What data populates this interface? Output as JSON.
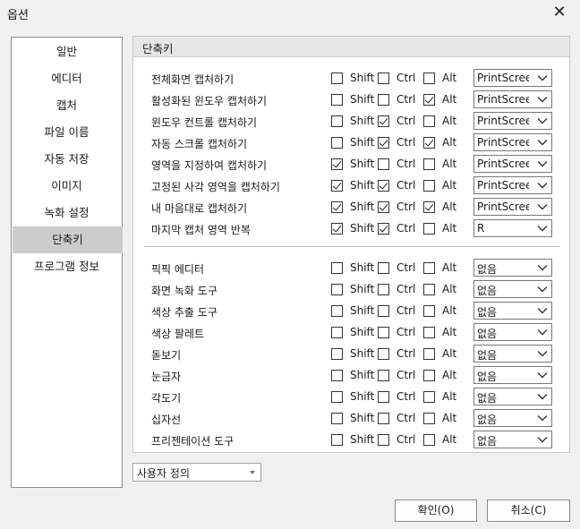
{
  "window": {
    "title": "옵션",
    "close_glyph": "✕"
  },
  "sidebar": {
    "items": [
      {
        "label": "일반"
      },
      {
        "label": "에디터"
      },
      {
        "label": "캡처"
      },
      {
        "label": "파일 이름"
      },
      {
        "label": "자동 저장"
      },
      {
        "label": "이미지"
      },
      {
        "label": "녹화 설정"
      },
      {
        "label": "단축키",
        "active": true
      },
      {
        "label": "프로그램 정보"
      }
    ]
  },
  "panel": {
    "title": "단축키",
    "modifier_labels": {
      "shift": "Shift",
      "ctrl": "Ctrl",
      "alt": "Alt"
    },
    "capture_shortcuts": [
      {
        "label": "전체화면 캡처하기",
        "shift": false,
        "ctrl": false,
        "alt": false,
        "key": "PrintScreen"
      },
      {
        "label": "활성화된 윈도우 캡처하기",
        "shift": false,
        "ctrl": false,
        "alt": true,
        "key": "PrintScreen"
      },
      {
        "label": "윈도우 컨트롤 캡처하기",
        "shift": false,
        "ctrl": true,
        "alt": false,
        "key": "PrintScreen"
      },
      {
        "label": "자동 스크롤 캡처하기",
        "shift": false,
        "ctrl": true,
        "alt": true,
        "key": "PrintScreen"
      },
      {
        "label": "영역을 지정하여 캡처하기",
        "shift": true,
        "ctrl": false,
        "alt": false,
        "key": "PrintScreen"
      },
      {
        "label": "고정된 사각 영역을 캡처하기",
        "shift": true,
        "ctrl": true,
        "alt": false,
        "key": "PrintScreen"
      },
      {
        "label": "내 마음대로 캡처하기",
        "shift": true,
        "ctrl": true,
        "alt": true,
        "key": "PrintScreen"
      },
      {
        "label": "마지막 캡처 영역 반복",
        "shift": true,
        "ctrl": true,
        "alt": false,
        "key": "R"
      }
    ],
    "tool_shortcuts": [
      {
        "label": "픽픽 에디터",
        "shift": false,
        "ctrl": false,
        "alt": false,
        "key": "없음"
      },
      {
        "label": "화면 녹화 도구",
        "shift": false,
        "ctrl": false,
        "alt": false,
        "key": "없음"
      },
      {
        "label": "색상 추출 도구",
        "shift": false,
        "ctrl": false,
        "alt": false,
        "key": "없음"
      },
      {
        "label": "색상 팔레트",
        "shift": false,
        "ctrl": false,
        "alt": false,
        "key": "없음"
      },
      {
        "label": "돋보기",
        "shift": false,
        "ctrl": false,
        "alt": false,
        "key": "없음"
      },
      {
        "label": "눈금자",
        "shift": false,
        "ctrl": false,
        "alt": false,
        "key": "없음"
      },
      {
        "label": "각도기",
        "shift": false,
        "ctrl": false,
        "alt": false,
        "key": "없음"
      },
      {
        "label": "십자선",
        "shift": false,
        "ctrl": false,
        "alt": false,
        "key": "없음"
      },
      {
        "label": "프리젠테이션 도구",
        "shift": false,
        "ctrl": false,
        "alt": false,
        "key": "없음"
      }
    ]
  },
  "profile_select": {
    "value": "사용자 정의"
  },
  "buttons": {
    "ok": "확인(O)",
    "cancel": "취소(C)"
  },
  "colors": {
    "active_nav": "#cccccc",
    "panel_header": "#e6e6e6",
    "window_bg": "#f0f0f0"
  },
  "icons": {
    "dropdown": "chevron-down-icon",
    "check": "checkmark-icon",
    "close": "close-icon"
  }
}
